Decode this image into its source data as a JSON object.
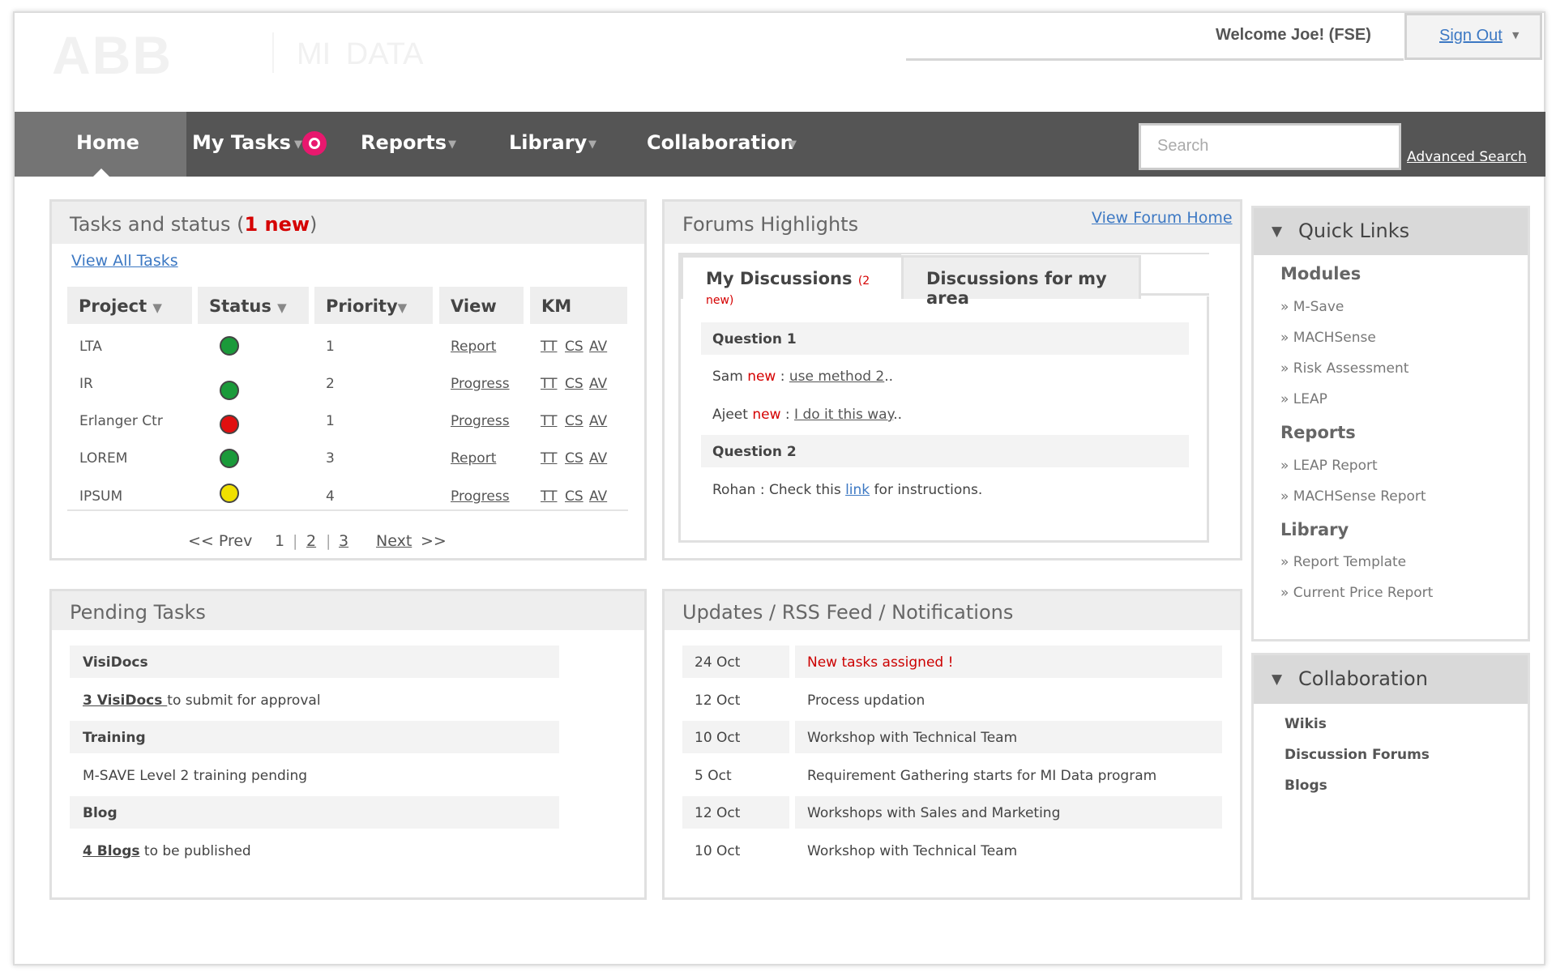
{
  "header": {
    "logo": "ABB",
    "app_name": "MI DATA",
    "welcome": "Welcome Joe!  (FSE)",
    "sign_out": "Sign Out"
  },
  "nav": {
    "items": [
      {
        "label": "Home"
      },
      {
        "label": "My Tasks"
      },
      {
        "label": "Reports"
      },
      {
        "label": "Library"
      },
      {
        "label": "Collaboration"
      }
    ],
    "search_placeholder": "Search",
    "advanced_search": "Advanced Search"
  },
  "tasks": {
    "title": "Tasks and status (",
    "title_new": "1 new",
    "title_end": ")",
    "view_all": "View All Tasks",
    "columns": [
      "Project",
      "Status",
      "Priority",
      "View",
      "KM"
    ],
    "rows": [
      {
        "project": "LTA",
        "status": "#1a9a3a",
        "priority": "1",
        "view": "Report",
        "km": [
          "TT",
          "CS",
          "AV"
        ]
      },
      {
        "project": "IR",
        "status": "#1a9a3a",
        "priority": "2",
        "view": "Progress",
        "km": [
          "TT",
          "CS",
          "AV"
        ]
      },
      {
        "project": "Erlanger Ctr",
        "status": "#e01010",
        "priority": "1",
        "view": "Progress",
        "km": [
          "TT",
          "CS",
          "AV"
        ]
      },
      {
        "project": "LOREM",
        "status": "#1a9a3a",
        "priority": "3",
        "view": "Report",
        "km": [
          "TT",
          "CS",
          "AV"
        ]
      },
      {
        "project": "IPSUM",
        "status": "#f0e000",
        "priority": "4",
        "view": "Progress",
        "km": [
          "TT",
          "CS",
          "AV"
        ]
      }
    ],
    "pager": {
      "prev": "<< Prev",
      "current": "1",
      "page2": "2",
      "page3": "3",
      "next": "Next",
      "next_arrow": ">>",
      "sep": "|"
    }
  },
  "forums": {
    "title": "Forums Highlights",
    "view_home": "View Forum Home",
    "tab1": "My Discussions",
    "tab1_new": "(2 new)",
    "tab2": "Discussions for my area",
    "q1": "Question 1",
    "a1_user": "Sam",
    "a1_new": "new",
    "a1_sep": " :  ",
    "a1_link": "use method 2",
    "a1_end": "..",
    "a2_user": "Ajeet",
    "a2_new": "new",
    "a2_sep": " : ",
    "a2_link": "I do it this way",
    "a2_end": "..",
    "q2": "Question 2",
    "a3_pre": "Rohan : Check this ",
    "a3_link": "link",
    "a3_post": " for instructions."
  },
  "quick_links": {
    "title": "Quick  Links",
    "sections": [
      {
        "heading": "Modules",
        "items": [
          "» M-Save",
          "» MACHSense",
          "» Risk Assessment",
          "» LEAP"
        ]
      },
      {
        "heading": "Reports",
        "items": [
          "» LEAP Report",
          "» MACHSense Report"
        ]
      },
      {
        "heading": "Library",
        "items": [
          "» Report Template",
          "» Current Price Report"
        ]
      }
    ]
  },
  "pending": {
    "title": "Pending Tasks",
    "visidocs_head": "VisiDocs",
    "visidocs_link": "3 VisiDocs ",
    "visidocs_text": "to submit for approval",
    "training_head": "Training",
    "training_text": "M-SAVE Level 2 training pending",
    "blog_head": "Blog",
    "blog_link": "4 Blogs",
    "blog_text": " to be published"
  },
  "updates": {
    "title": "Updates / RSS Feed / Notifications",
    "rows": [
      {
        "date": "24 Oct",
        "text": "New tasks assigned !"
      },
      {
        "date": "12 Oct",
        "text": "Process updation"
      },
      {
        "date": "10 Oct",
        "text": "Workshop with Technical Team"
      },
      {
        "date": "5 Oct",
        "text": "Requirement Gathering starts for MI Data program"
      },
      {
        "date": "12 Oct",
        "text": "Workshops with Sales and Marketing"
      },
      {
        "date": "10 Oct",
        "text": "Workshop with Technical Team"
      }
    ]
  },
  "collaboration": {
    "title": "Collaboration",
    "items": [
      "Wikis",
      "Discussion Forums",
      "Blogs"
    ]
  },
  "colors": {
    "nav": "#555555",
    "accent_red": "#d50000",
    "link_blue": "#3c78c3",
    "badge": "#e8186e"
  }
}
